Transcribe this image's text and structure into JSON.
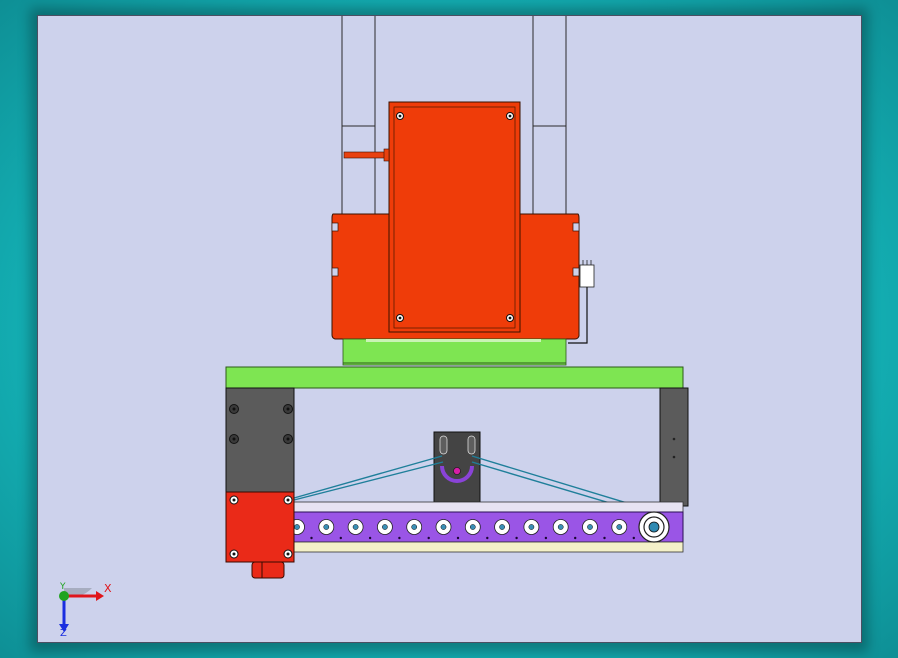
{
  "axes": {
    "x_label": "X",
    "y_label": "Y",
    "z_label": "Z",
    "x_color": "#e0151b",
    "y_color": "#1fa31f",
    "z_color": "#1a2ee0"
  },
  "colors": {
    "viewport_background": "#cdd2ec",
    "motor_housing": "#ef3c09",
    "mount_plate": "#7ee552",
    "belt_rail": "#9a55e6",
    "side_bracket": "#5b5b5b",
    "drive_motor": "#ea2a18",
    "belt": "#1f7f9a",
    "idler_holder": "#444444"
  },
  "model": {
    "rail_roller_count": 12
  }
}
